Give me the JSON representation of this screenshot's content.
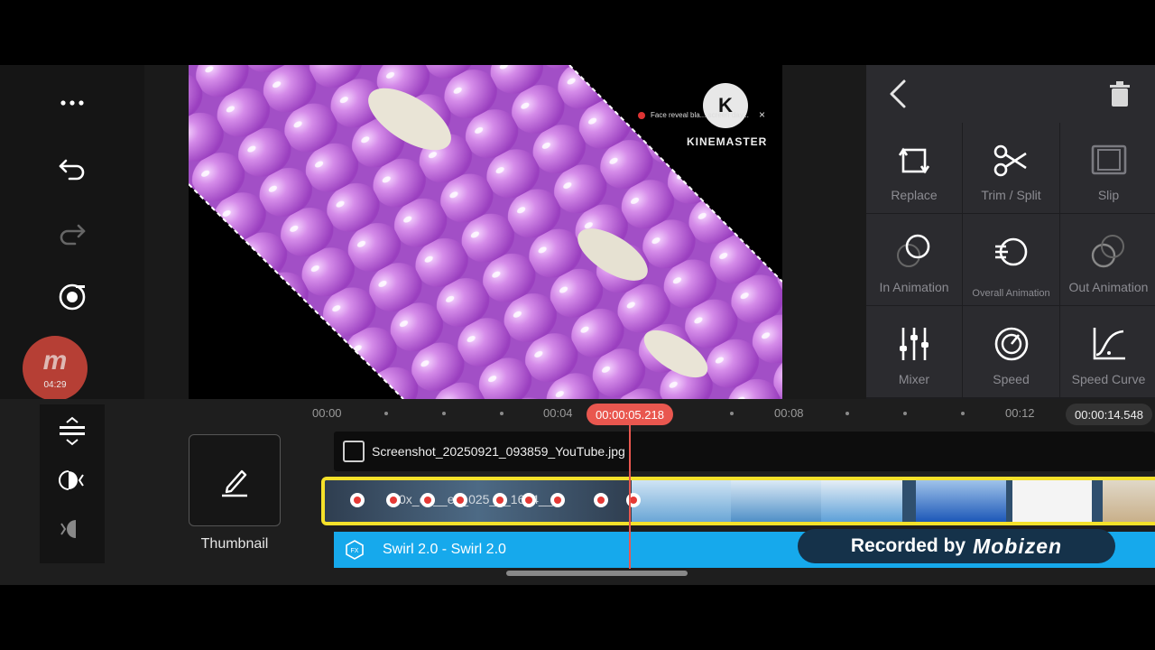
{
  "preview": {
    "watermark_letter": "K",
    "watermark_text": "KINEMASTER",
    "notification_text": "Face reveal bla... screen day...",
    "notification_close": "×"
  },
  "recorder": {
    "mark": "m",
    "time": "04:29",
    "banner_prefix": "Recorded by",
    "banner_brand": "Mobizen"
  },
  "panel": {
    "items": [
      {
        "label": "Replace"
      },
      {
        "label": "Trim / Split"
      },
      {
        "label": "Slip"
      },
      {
        "label": "In Animation"
      },
      {
        "label": "Overall Animation"
      },
      {
        "label": "Out Animation"
      },
      {
        "label": "Mixer"
      },
      {
        "label": "Speed"
      },
      {
        "label": "Speed Curve"
      }
    ]
  },
  "timeline": {
    "thumbnail_label": "Thumbnail",
    "ruler": [
      "00:00",
      "00:04",
      "00:08",
      "00:12"
    ],
    "playhead_time": "00:00:05.218",
    "end_time": "00:00:14.548",
    "image_clip_name": "Screenshot_20250921_093859_YouTube.jpg",
    "video_clip_name": "0x_ob__en_025_9_16_4__4",
    "fx_clip_name": "Swirl 2.0 - Swirl 2.0"
  },
  "colors": {
    "accent": "#e9574f",
    "clip_select": "#f5e12a",
    "fx_track": "#16a9ec",
    "preview_pink": "#d07ee6"
  },
  "icons": {
    "more": "more-horizontal-icon",
    "undo": "undo-icon",
    "redo": "redo-icon",
    "record": "record-icon",
    "back": "chevron-left-icon",
    "delete": "trash-icon"
  }
}
